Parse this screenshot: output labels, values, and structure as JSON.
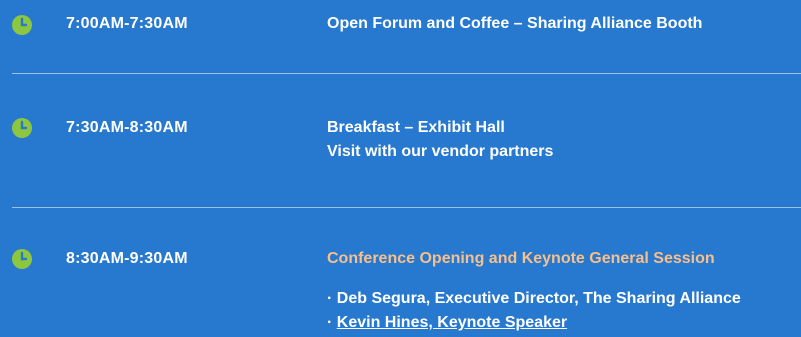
{
  "colors": {
    "background": "#2778cf",
    "clock": "#8dc63f",
    "highlight": "#f7c08a",
    "text": "#ffffff"
  },
  "schedule": [
    {
      "time": "7:00AM-7:30AM",
      "title": "Open Forum and Coffee – Sharing Alliance Booth",
      "icon": "clock-icon"
    },
    {
      "time": "7:30AM-8:30AM",
      "title": "Breakfast – Exhibit Hall",
      "subtitle": "Visit with our vendor partners",
      "icon": "clock-icon"
    },
    {
      "time": "8:30AM-9:30AM",
      "title": "Conference Opening and Keynote General Session",
      "icon": "clock-icon",
      "speakers": [
        {
          "prefix": "· ",
          "text": "Deb Segura, Executive Director, The Sharing Alliance"
        },
        {
          "prefix": "· ",
          "text": "Kevin Hines, Keynote Speaker"
        }
      ]
    }
  ]
}
